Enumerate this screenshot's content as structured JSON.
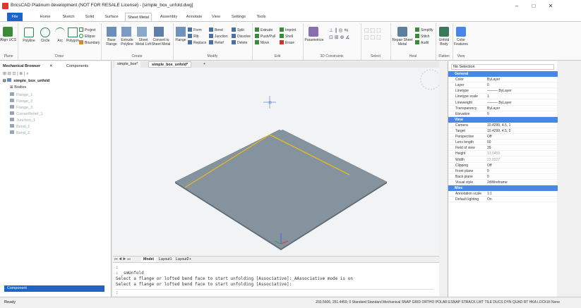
{
  "window": {
    "title": "BricsCAD Platinum development (NOT FOR RESALE License) - [simple_box_unfold.dwg]",
    "min": "–",
    "max": "□",
    "close": "✕"
  },
  "ribbon_tabs": [
    "File",
    "Home",
    "Sketch",
    "Solid",
    "Surface",
    "Sheet Metal",
    "Assembly",
    "Annotate",
    "View",
    "Settings",
    "Tools"
  ],
  "active_tab": "Sheet Metal",
  "ribbon": {
    "plane": {
      "label": "Plane",
      "align_ucs": "Align UCS"
    },
    "draw": {
      "label": "Draw",
      "polyline": "Polyline",
      "circle": "Circle",
      "arc": "Arc",
      "polygon": "Polygon",
      "project": "Project",
      "ellipse": "Ellipse",
      "boundary": "Boundary"
    },
    "create": {
      "label": "Create",
      "base_flange": "Base Flange",
      "extrude_polyline": "Extrude Polyline",
      "sheet_metal_loft": "Sheet Metal Loft",
      "convert_to_sheet_metal": "Convert to Sheet Metal"
    },
    "modify": {
      "label": "Modify",
      "flange": "Flange",
      "form": "Form",
      "rib": "Rib",
      "replace": "Replace",
      "bend": "Bend",
      "junction": "Junction",
      "relief": "Relief",
      "split": "Split",
      "dissolve": "Dissolve",
      "delete": "Delete"
    },
    "edit": {
      "label": "Edit",
      "extrude": "Extrude",
      "push_pull": "Push/Pull",
      "move": "Move",
      "imprint": "Imprint",
      "shell": "Shell",
      "erase": "Erase"
    },
    "constraints": {
      "label": "3D Constraints",
      "parametrize": "Parametrize"
    },
    "select": {
      "label": "Select"
    },
    "heal": {
      "label": "Heal",
      "repair_sheet_metal": "Repair Sheet Metal",
      "simplify": "Simplify",
      "stitch": "Stitch",
      "audit": "Audit"
    },
    "flatten": {
      "label": "Flatten",
      "unfold_body": "Unfold Body"
    },
    "view": {
      "label": "View",
      "color_features": "Color Features"
    }
  },
  "browser": {
    "tabs": [
      "Mechanical Browser",
      "Components"
    ],
    "root": "simple_box_unfold",
    "items": [
      "Bodies",
      "Flange_1",
      "Flange_2",
      "Flange_3",
      "CornerRelief_1",
      "Junction_1",
      "Bend_1",
      "Bend_2"
    ],
    "footer_dropdown": "Component"
  },
  "doc_tabs": [
    "simple_box*",
    "simple_box_unfold*"
  ],
  "layout_tabs": [
    "Model",
    "Layout1",
    "Layout2"
  ],
  "command_lines": [
    ":",
    ": _smUnfold",
    "Select a flange or lofted bend face to start unfolding [Associative]:_AAssociative mode is on",
    "Select a flange or lofted bend face to start unfolding [Associative]:",
    ":"
  ],
  "properties": {
    "selection": "No Selection",
    "sections": [
      {
        "name": "General",
        "rows": [
          [
            "Color",
            "ByLayer"
          ],
          [
            "Layer",
            "0"
          ],
          [
            "Linetype",
            "——— ByLayer"
          ],
          [
            "Linetype scale",
            "1"
          ],
          [
            "Lineweight",
            "——— ByLayer"
          ],
          [
            "Transparency",
            "ByLayer"
          ],
          [
            "Elevation",
            "0"
          ]
        ]
      },
      {
        "name": "View",
        "rows": [
          [
            "Camera",
            "10.4299, 4.5, 1"
          ],
          [
            "Target",
            "10.4299, 4.5, 0"
          ],
          [
            "Perspective",
            "Off"
          ],
          [
            "Lens length",
            "50"
          ],
          [
            "Field of view",
            "39"
          ],
          [
            "Height",
            "13.0459"
          ],
          [
            "Width",
            "23.0227"
          ],
          [
            "Clipping",
            "Off"
          ],
          [
            "Front plane",
            "0"
          ],
          [
            "Back plane",
            "0"
          ],
          [
            "Visual style",
            "2dWireframe"
          ]
        ]
      },
      {
        "name": "Misc",
        "rows": [
          [
            "Annotation scale",
            "1:1"
          ],
          [
            "Default lighting",
            "On"
          ]
        ]
      }
    ]
  },
  "status": {
    "ready": "Ready",
    "coords": "233.5606, 251.4459, 0  Standard  Standard  Mechanical  SNAP  GRID  ORTHO  POLAR  ESNAP  STRACK  LWT  TILE  DUCS  DYN  QUAD  RT  HKA  LOCKUI  None"
  },
  "colors": {
    "accent": "#1f63c6",
    "section": "#4a86e8",
    "plate": "#7f8c96",
    "bendline": "#f0c020"
  }
}
